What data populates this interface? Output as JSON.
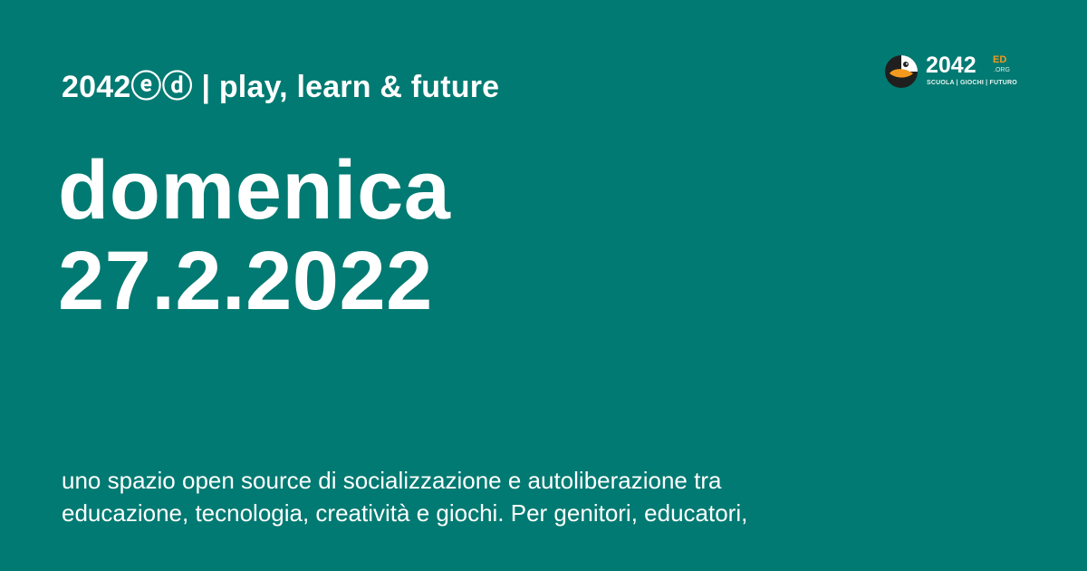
{
  "header": {
    "site_title": "2042ⓔⓓ | play, learn & future"
  },
  "logo": {
    "wordmark": "2042",
    "superscript": "ED",
    "subscript": ".ORG",
    "tagline": "SCUOLA | GIOCHI | FUTURO",
    "colors": {
      "accent": "#f39a1e",
      "mark_dark": "#1f1f1f",
      "mark_light": "#ffffff"
    }
  },
  "event": {
    "day": "domenica",
    "date": "27.2.2022"
  },
  "description": {
    "line1": "uno spazio open source di socializzazione e autoliberazione tra",
    "line2": "educazione, tecnologia, creatività e giochi. Per genitori, educatori,"
  },
  "theme": {
    "background": "#007a72",
    "text": "#ffffff"
  }
}
